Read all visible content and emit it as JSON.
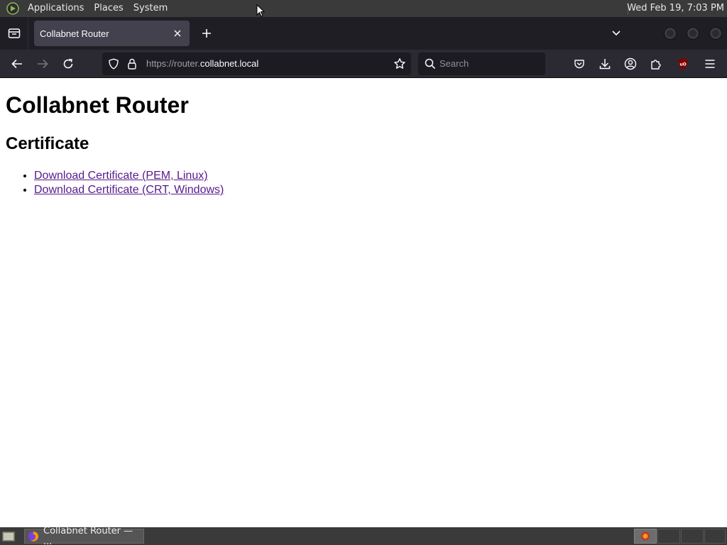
{
  "system_panel": {
    "menus": [
      "Applications",
      "Places",
      "System"
    ],
    "clock": "Wed Feb 19,  7:03 PM"
  },
  "browser": {
    "tab": {
      "title": "Collabnet Router"
    },
    "url": {
      "scheme_prefix": "https://router.",
      "host": "collabnet.local"
    },
    "search": {
      "placeholder": "Search"
    },
    "icons": {
      "back": "arrow-left-icon",
      "forward": "arrow-right-icon",
      "reload": "reload-icon",
      "shield": "tracking-shield-icon",
      "lock": "lock-icon",
      "bookmark": "star-icon",
      "pocket": "pocket-icon",
      "downloads": "download-icon",
      "account": "account-icon",
      "extensions": "extensions-icon",
      "ublock": "ublock-origin-icon",
      "menu": "hamburger-menu-icon"
    },
    "accent": "#fbfbfe",
    "chrome_bg": "#2b2a33"
  },
  "page": {
    "title": "Collabnet Router",
    "section": "Certificate",
    "links": [
      "Download Certificate (PEM, Linux)",
      "Download Certificate (CRT, Windows)"
    ],
    "link_color": "#551a8b"
  },
  "taskbar": {
    "window_title": "Collabnet Router — ..."
  }
}
